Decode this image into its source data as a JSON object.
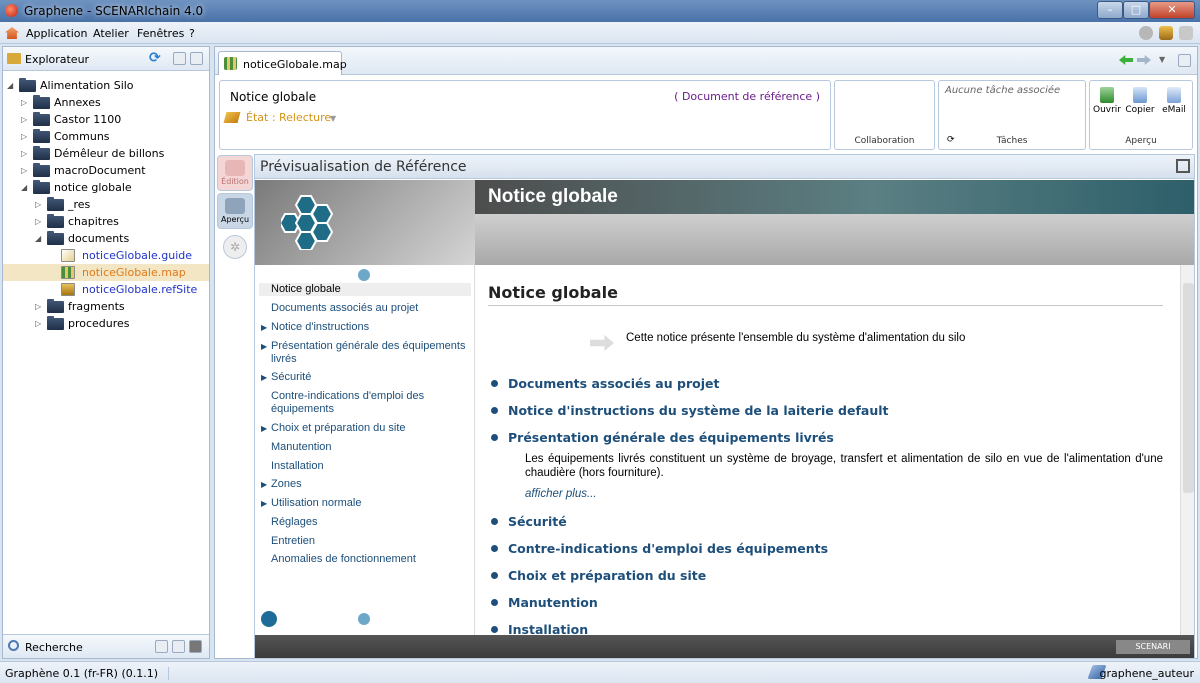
{
  "window": {
    "title": "Graphene - SCENARIchain 4.0"
  },
  "menu": {
    "items": [
      "Application",
      "Atelier",
      "Fenêtres",
      "?"
    ]
  },
  "explorer": {
    "title": "Explorateur",
    "tree": [
      {
        "label": "Alimentation Silo",
        "depth": 0,
        "expanded": true
      },
      {
        "label": "Annexes",
        "depth": 1
      },
      {
        "label": "Castor 1100",
        "depth": 1
      },
      {
        "label": "Communs",
        "depth": 1
      },
      {
        "label": "Démêleur de billons",
        "depth": 1
      },
      {
        "label": "macroDocument",
        "depth": 1
      },
      {
        "label": "notice globale",
        "depth": 1,
        "expanded": true
      },
      {
        "label": "_res",
        "depth": 2
      },
      {
        "label": "chapitres",
        "depth": 2
      },
      {
        "label": "documents",
        "depth": 2,
        "expanded": true
      },
      {
        "label": "noticeGlobale.guide",
        "depth": 3,
        "file": true
      },
      {
        "label": "noticeGlobale.map",
        "depth": 3,
        "file": true,
        "selected": true
      },
      {
        "label": "noticeGlobale.refSite",
        "depth": 3,
        "file": true
      },
      {
        "label": "fragments",
        "depth": 2
      },
      {
        "label": "procedures",
        "depth": 2
      }
    ]
  },
  "search": {
    "title": "Recherche"
  },
  "status": {
    "left": "Graphène 0.1 (fr-FR) (0.1.1)",
    "user": "graphene_auteur"
  },
  "editor": {
    "tab_label": "noticeGlobale.map",
    "doc_title": "Notice globale",
    "ref_doc": "( Document de référence )",
    "state": "État : Relecture",
    "collab_label": "Collaboration",
    "no_task": "Aucune tâche associée",
    "tasks_label": "Tâches",
    "apercu_label": "Aperçu",
    "actions": [
      "Ouvrir",
      "Copier",
      "eMail"
    ],
    "view_edition": "Édition",
    "view_apercu": "Aperçu"
  },
  "preview": {
    "header": "Prévisualisation de Référence",
    "banner_title": "Notice globale",
    "scenari_badge": "SCENARI",
    "toc": [
      {
        "label": "Notice globale",
        "active": true
      },
      {
        "label": "Documents associés au projet"
      },
      {
        "label": "Notice d'instructions",
        "expandable": true
      },
      {
        "label": "Présentation générale des équipements livrés",
        "expandable": true
      },
      {
        "label": "Sécurité",
        "expandable": true
      },
      {
        "label": "Contre-indications d'emploi des équipements"
      },
      {
        "label": "Choix et préparation du site",
        "expandable": true
      },
      {
        "label": "Manutention"
      },
      {
        "label": "Installation"
      },
      {
        "label": "Zones",
        "expandable": true
      },
      {
        "label": "Utilisation normale",
        "expandable": true
      },
      {
        "label": "Réglages"
      },
      {
        "label": "Entretien"
      },
      {
        "label": "Anomalies de fonctionnement"
      }
    ],
    "content": {
      "title": "Notice globale",
      "intro": "Cette notice présente l'ensemble du système d'alimentation du silo",
      "sections": [
        "Documents associés au projet",
        "Notice d'instructions du système de la laiterie default",
        "Présentation générale des équipements livrés",
        "Sécurité",
        "Contre-indications d'emploi des équipements",
        "Choix et préparation du site",
        "Manutention",
        "Installation"
      ],
      "section_desc": "Les équipements livrés constituent un système de broyage, transfert et alimentation de silo en vue de l'alimentation d'une chaudière (hors fourniture).",
      "more": "afficher plus..."
    }
  }
}
